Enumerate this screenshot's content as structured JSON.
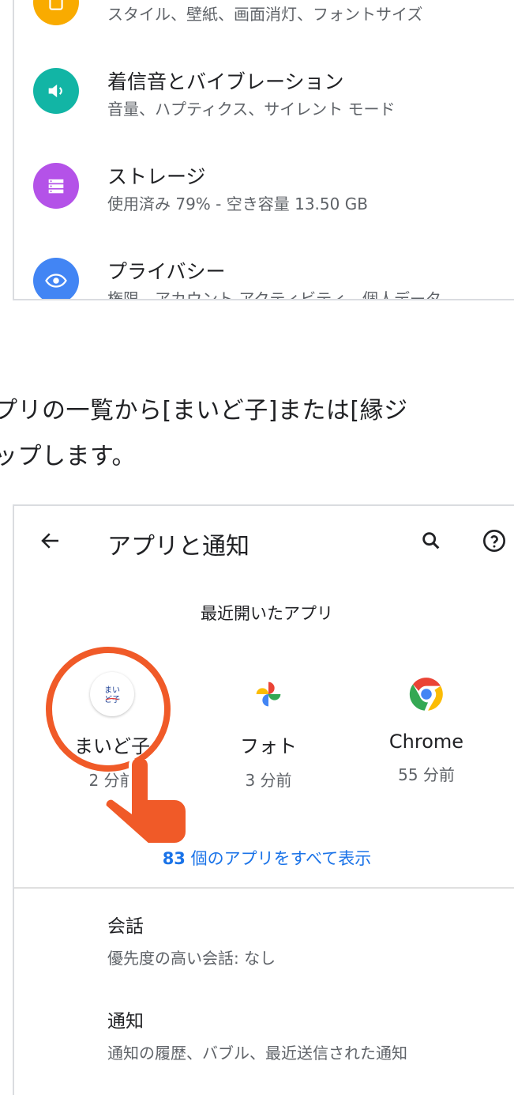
{
  "settings": {
    "items": [
      {
        "title": "",
        "subtitle": "スタイル、壁紙、画面消灯、フォントサイズ",
        "color": "#f9ab00",
        "icon": "display-icon"
      },
      {
        "title": "着信音とバイブレーション",
        "subtitle": "音量、ハプティクス、サイレント モード",
        "color": "#12b5a5",
        "icon": "sound-icon"
      },
      {
        "title": "ストレージ",
        "subtitle": "使用済み 79% - 空き容量 13.50 GB",
        "color": "#b452e8",
        "icon": "storage-icon"
      },
      {
        "title": "プライバシー",
        "subtitle": "権限、アカウント アクティビティ、個人データ",
        "color": "#4285f4",
        "icon": "privacy-icon"
      }
    ]
  },
  "instruction": {
    "line1": "プリの一覧から[まいど子]または[縁ジ",
    "line2": "ップします。"
  },
  "apps_screen": {
    "title": "アプリと通知",
    "recent_title": "最近開いたアプリ",
    "recent_apps": [
      {
        "name": "まいど子",
        "time": "2 分前",
        "icon": "maidoko-app-icon"
      },
      {
        "name": "フォト",
        "time": "3 分前",
        "icon": "photos-app-icon"
      },
      {
        "name": "Chrome",
        "time": "55 分前",
        "icon": "chrome-app-icon"
      }
    ],
    "see_all_count": "83",
    "see_all_label": " 個のアプリをすべて表示",
    "rows": [
      {
        "title": "会話",
        "subtitle": "優先度の高い会話: なし"
      },
      {
        "title": "通知",
        "subtitle": "通知の履歴、バブル、最近送信された通知"
      }
    ],
    "accent": "#1a73e8"
  },
  "annotation": {
    "color": "#f05a28"
  }
}
